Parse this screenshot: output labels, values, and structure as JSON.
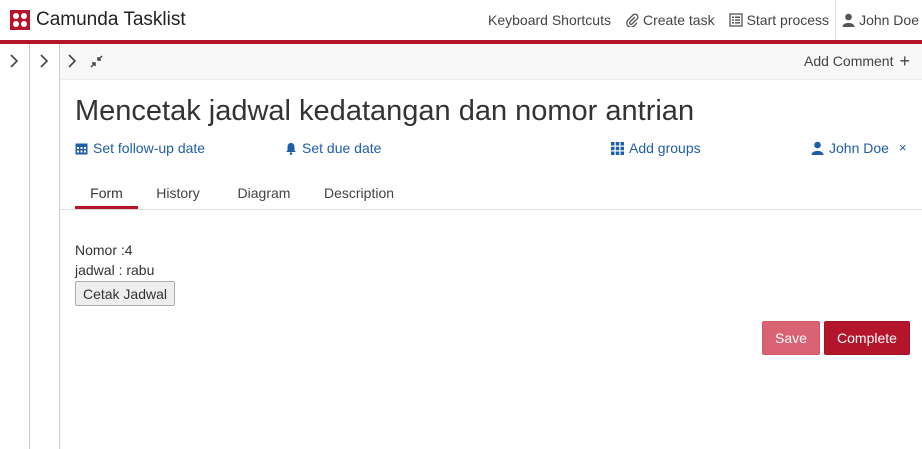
{
  "header": {
    "app_name": "Camunda Tasklist",
    "nav": {
      "keyboard_shortcuts": "Keyboard Shortcuts",
      "create_task": "Create task",
      "start_process": "Start process",
      "user": "John Doe"
    },
    "icons": {
      "logo": "camunda-logo",
      "create_task": "paperclip-icon",
      "start_process": "list-alt-icon",
      "user": "user-icon"
    }
  },
  "colors": {
    "brand": "#b5152b",
    "link": "#1f5ea8",
    "save_button": "#d96372",
    "complete_button": "#b5152b"
  },
  "toolbar": {
    "add_comment": "Add Comment",
    "add_comment_plus": "+"
  },
  "task": {
    "title": "Mencetak jadwal kedatangan dan nomor antrian",
    "follow_up": "Set follow-up date",
    "due_date": "Set due date",
    "groups": "Add groups",
    "assignee": "John Doe",
    "remove_assignee": "×"
  },
  "tabs": [
    {
      "label": "Form",
      "active": true
    },
    {
      "label": "History",
      "active": false
    },
    {
      "label": "Diagram",
      "active": false
    },
    {
      "label": "Description",
      "active": false
    }
  ],
  "form": {
    "nomor_line": "Nomor :4",
    "jadwal_line": "jadwal : rabu",
    "cetak_button": "Cetak Jadwal"
  },
  "actions": {
    "save": "Save",
    "complete": "Complete"
  }
}
